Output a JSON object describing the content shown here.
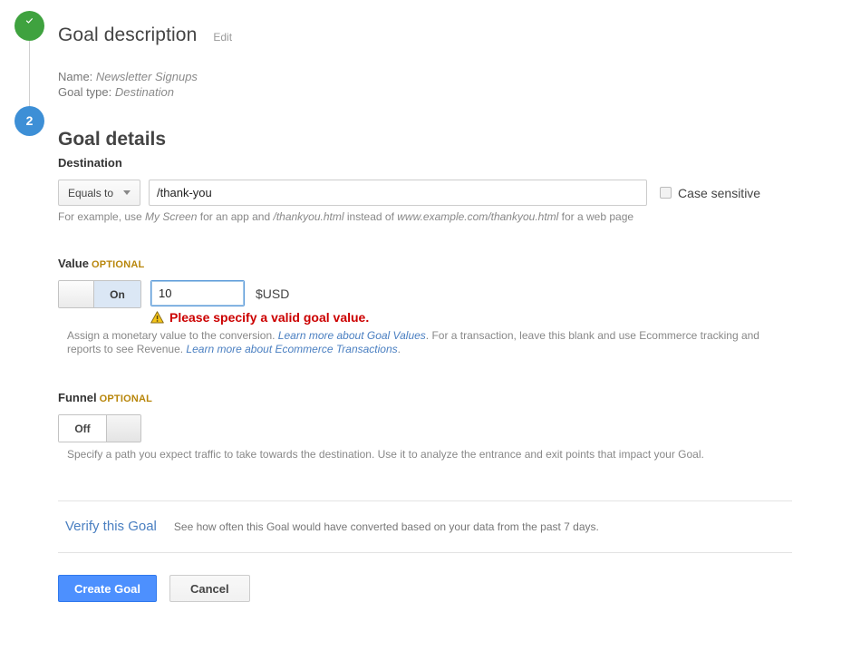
{
  "steps": {
    "step1": {
      "state_icon": "check-circle-icon",
      "title": "Goal description",
      "edit_label": "Edit",
      "name_prefix": "Name:",
      "name_value": "Newsletter Signups",
      "type_prefix": "Goal type:",
      "type_value": "Destination"
    },
    "step2": {
      "number": "2",
      "title": "Goal details"
    }
  },
  "destination": {
    "label": "Destination",
    "match_type": "Equals to",
    "value": "/thank-you",
    "placeholder": "",
    "case_sensitive_label": "Case sensitive",
    "case_sensitive_checked": false,
    "help_a": "For example, use ",
    "help_em1": "My Screen",
    "help_b": " for an app and ",
    "help_em2": "/thankyou.html",
    "help_c": " instead of ",
    "help_em3": "www.example.com/thankyou.html",
    "help_d": " for a web page"
  },
  "value": {
    "label": "Value",
    "optional_label": "OPTIONAL",
    "toggle_state": "On",
    "amount": "10",
    "currency_label": "$USD",
    "error_icon": "warning-triangle-icon",
    "error_text": "Please specify a valid goal value.",
    "help_a": "Assign a monetary value to the conversion. ",
    "help_link1": "Learn more about Goal Values",
    "help_b": ". For a transaction, leave this blank and use Ecommerce tracking and reports to see Revenue. ",
    "help_link2": "Learn more about Ecommerce Transactions",
    "help_c": "."
  },
  "funnel": {
    "label": "Funnel",
    "optional_label": "OPTIONAL",
    "toggle_state": "Off",
    "help": "Specify a path you expect traffic to take towards the destination. Use it to analyze the entrance and exit points that impact your Goal."
  },
  "verify": {
    "link_label": "Verify this Goal",
    "note": "See how often this Goal would have converted based on your data from the past 7 days."
  },
  "actions": {
    "primary_label": "Create Goal",
    "secondary_label": "Cancel"
  },
  "colors": {
    "step_done": "#3fa23f",
    "step_current": "#3d8fd6",
    "link": "#4a7fc1",
    "error": "#cc0000",
    "optional": "#b8860b",
    "primary_button": "#4d90fe"
  }
}
